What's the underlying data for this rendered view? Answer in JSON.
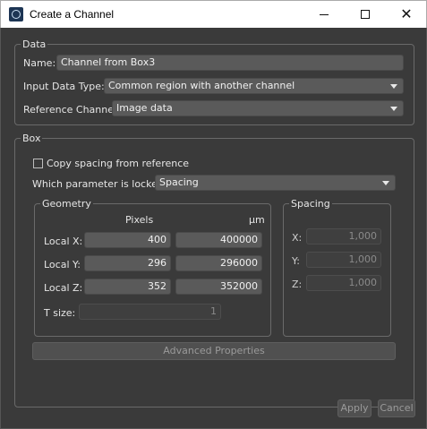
{
  "window": {
    "title": "Create a Channel",
    "icon": "app-icon"
  },
  "data_group": {
    "legend": "Data",
    "name_label": "Name:",
    "name_value": "Channel from Box3",
    "input_type_label": "Input Data Type:",
    "input_type_value": "Common region with another channel",
    "reference_label": "Reference Channel",
    "reference_value": "Image data"
  },
  "box_group": {
    "legend": "Box",
    "copy_spacing_label": "Copy spacing from reference",
    "copy_spacing_checked": false,
    "locked_label": "Which parameter is locked:",
    "locked_value": "Spacing",
    "geometry": {
      "legend": "Geometry",
      "col_pixels": "Pixels",
      "col_um": "µm",
      "rows": [
        {
          "label": "Local X:",
          "pixels": "400",
          "um": "400000"
        },
        {
          "label": "Local Y:",
          "pixels": "296",
          "um": "296000"
        },
        {
          "label": "Local Z:",
          "pixels": "352",
          "um": "352000"
        }
      ],
      "t_size_label": "T size:",
      "t_size_value": "1"
    },
    "spacing": {
      "legend": "Spacing",
      "rows": [
        {
          "label": "X:",
          "value": "1,000"
        },
        {
          "label": "Y:",
          "value": "1,000"
        },
        {
          "label": "Z:",
          "value": "1,000"
        }
      ]
    },
    "advanced_button": "Advanced Properties"
  },
  "buttons": {
    "apply": "Apply",
    "cancel": "Cancel"
  }
}
